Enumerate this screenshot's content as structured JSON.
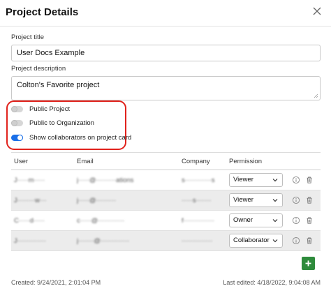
{
  "dialog": {
    "title": "Project Details"
  },
  "form": {
    "project_title_label": "Project title",
    "project_title_value": "User Docs Example",
    "project_description_label": "Project description",
    "project_description_value": "Colton's Favorite project"
  },
  "toggles": [
    {
      "label": "Public Project",
      "on": false
    },
    {
      "label": "Public to Organization",
      "on": false
    },
    {
      "label": "Show collaborators on project card",
      "on": true
    }
  ],
  "table": {
    "headers": [
      "User",
      "Email",
      "Company",
      "Permission"
    ],
    "rows": [
      {
        "user": "J·····m·····",
        "email": "j·····@·········ations",
        "company": "s············s",
        "permission": "Viewer"
      },
      {
        "user": "J········w···",
        "email": "j·····@·········",
        "company": "·····s·······",
        "permission": "Viewer"
      },
      {
        "user": "C·····d·····",
        "email": "c·····@············",
        "company": "f··············",
        "permission": "Owner"
      },
      {
        "user": "J·············",
        "email": "j·······@·············",
        "company": "··············",
        "permission": "Collaborator"
      }
    ]
  },
  "footer": {
    "created": "Created: 9/24/2021, 2:01:04 PM",
    "last_edited": "Last edited: 4/18/2022, 9:04:08 AM"
  },
  "icons": {
    "close": "close-icon",
    "info": "info-icon",
    "trash": "trash-icon",
    "chevron": "chevron-down-icon",
    "add": "plus-icon"
  },
  "colors": {
    "toggle_on": "#1a6fe8",
    "highlight": "#e1221c",
    "add_button": "#2e8b3c"
  }
}
